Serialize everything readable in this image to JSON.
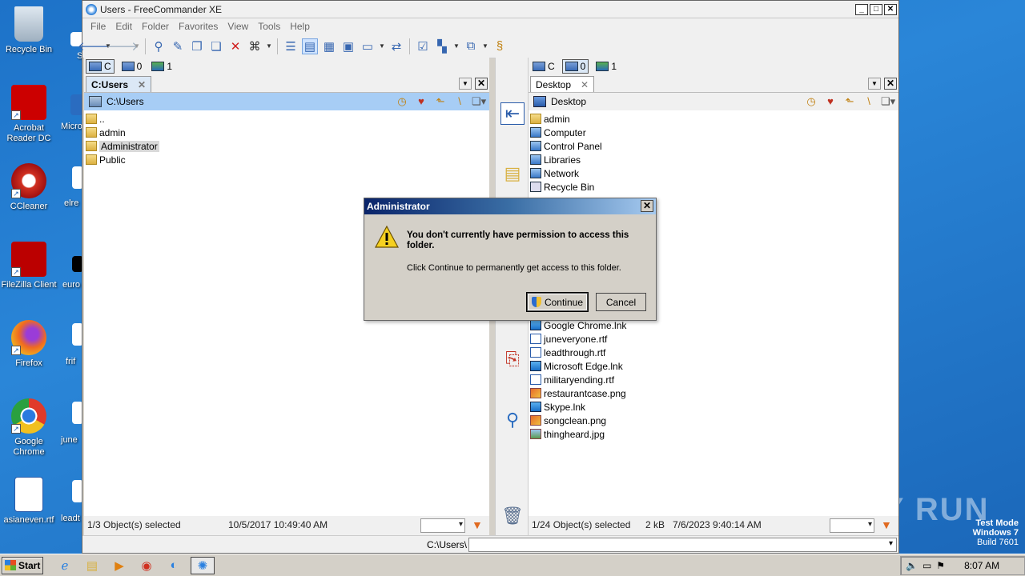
{
  "desktop": {
    "icons": [
      {
        "label": "Recycle Bin",
        "icon": "recycle-bin-icon"
      },
      {
        "label": "Acrobat Reader DC",
        "icon": "acrobat-icon"
      },
      {
        "label": "CCleaner",
        "icon": "ccleaner-icon"
      },
      {
        "label": "FileZilla Client",
        "icon": "filezilla-icon"
      },
      {
        "label": "Firefox",
        "icon": "firefox-icon"
      },
      {
        "label": "Google Chrome",
        "icon": "chrome-icon"
      },
      {
        "label": "asianeven.rtf",
        "icon": "word-doc-icon"
      }
    ],
    "partial_labels": [
      "S",
      "Micro",
      "elre",
      "euro",
      "frif",
      "june",
      "leadt"
    ]
  },
  "window": {
    "title": "Users - FreeCommander XE",
    "menu": [
      "File",
      "Edit",
      "Folder",
      "Favorites",
      "View",
      "Tools",
      "Help"
    ]
  },
  "left_pane": {
    "drives": [
      {
        "label": "C"
      },
      {
        "label": "0"
      },
      {
        "label": "1"
      }
    ],
    "tab": "C:Users",
    "path": "C:\\Users",
    "items": [
      {
        "name": "..",
        "type": "up"
      },
      {
        "name": "admin",
        "type": "user"
      },
      {
        "name": "Administrator",
        "type": "folder",
        "highlighted": true
      },
      {
        "name": "Public",
        "type": "folder"
      }
    ],
    "status": "1/3 Object(s) selected",
    "date": "10/5/2017 10:49:40 AM"
  },
  "right_pane": {
    "drives": [
      {
        "label": "C"
      },
      {
        "label": "0"
      },
      {
        "label": "1"
      }
    ],
    "tab": "Desktop",
    "path": "Desktop",
    "items_top": [
      {
        "name": "admin",
        "type": "user"
      },
      {
        "name": "Computer",
        "type": "sys"
      },
      {
        "name": "Control Panel",
        "type": "sys"
      },
      {
        "name": "Libraries",
        "type": "sys"
      },
      {
        "name": "Network",
        "type": "sys"
      },
      {
        "name": "Recycle Bin",
        "type": "sys"
      }
    ],
    "items_bottom": [
      {
        "name": "Google Chrome.lnk",
        "type": "lnk"
      },
      {
        "name": "juneveryone.rtf",
        "type": "doc"
      },
      {
        "name": "leadthrough.rtf",
        "type": "doc"
      },
      {
        "name": "Microsoft Edge.lnk",
        "type": "lnk"
      },
      {
        "name": "militaryending.rtf",
        "type": "doc"
      },
      {
        "name": "restaurantcase.png",
        "type": "img"
      },
      {
        "name": "Skype.lnk",
        "type": "lnk"
      },
      {
        "name": "songclean.png",
        "type": "img"
      },
      {
        "name": "thingheard.jpg",
        "type": "img"
      }
    ],
    "status": "1/24 Object(s) selected",
    "size": "2 kB",
    "date": "7/6/2023 9:40:14 AM"
  },
  "command_line": {
    "label": "C:\\Users\\"
  },
  "dialog": {
    "title": "Administrator",
    "message": "You don't currently have permission to access this folder.",
    "detail": "Click Continue to permanently get access to this folder.",
    "continue_label": "Continue",
    "cancel_label": "Cancel"
  },
  "taskbar": {
    "start_label": "Start",
    "time": "8:07 AM"
  },
  "watermark": {
    "line1": "Test Mode",
    "line2": "Windows 7",
    "line3": "Build 7601",
    "brand": "ANY RUN"
  }
}
